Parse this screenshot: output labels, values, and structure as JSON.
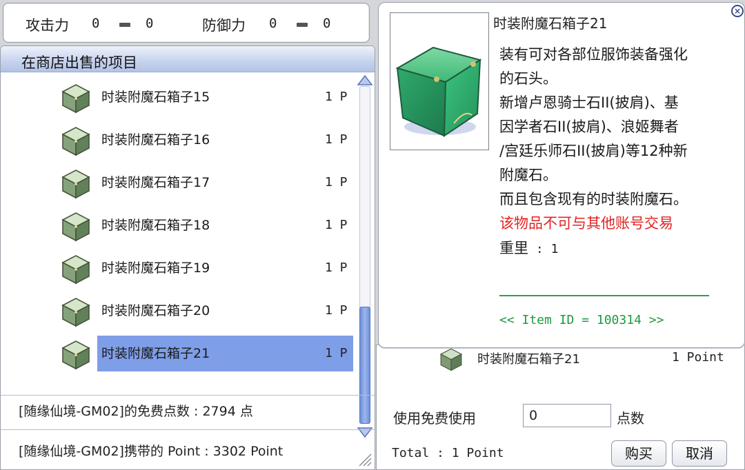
{
  "stats": {
    "attack_label": "攻击力",
    "attack_base": "0",
    "attack_bonus": "0",
    "defense_label": "防御力",
    "defense_base": "0",
    "defense_bonus": "0"
  },
  "shop": {
    "title": "在商店出售的项目",
    "items": [
      {
        "name": "时装附魔石箱子15",
        "price": "1 P",
        "selected": false
      },
      {
        "name": "时装附魔石箱子16",
        "price": "1 P",
        "selected": false
      },
      {
        "name": "时装附魔石箱子17",
        "price": "1 P",
        "selected": false
      },
      {
        "name": "时装附魔石箱子18",
        "price": "1 P",
        "selected": false
      },
      {
        "name": "时装附魔石箱子19",
        "price": "1 P",
        "selected": false
      },
      {
        "name": "时装附魔石箱子20",
        "price": "1 P",
        "selected": false
      },
      {
        "name": "时装附魔石箱子21",
        "price": "1 P",
        "selected": true
      }
    ],
    "free_points_text": "[随缘仙境-GM02]的免费点数 : 2794 点",
    "carried_points_text": "[随缘仙境-GM02]携带的 Point : 3302 Point"
  },
  "tooltip": {
    "title": "时装附魔石箱子21",
    "desc_lines": [
      "装有可对各部位服饰装备强化",
      "的石头。",
      "新增卢恩骑士石II(披肩)、基",
      "因学者石II(披肩)、浪姬舞者",
      "/宫廷乐师石II(披肩)等12种新",
      "附魔石。",
      "而且包含现有的时装附魔石。"
    ],
    "trade_warning": "该物品不可与其他账号交易",
    "weight_label": "重里",
    "weight_sep": " : ",
    "weight_value": "1",
    "item_id_text": "<< Item ID = 100314 >>"
  },
  "purchase": {
    "item_name": "时装附魔石箱子21",
    "item_points": "1 Point",
    "free_use_label": "使用免费使用",
    "free_use_value": "0",
    "points_unit": "点数",
    "total_text": "Total : 1 Point",
    "buy_label": "购买",
    "cancel_label": "取消"
  },
  "colors": {
    "selection": "#7f9ee8",
    "title_bar": "#c9d5ee",
    "warning_red": "#e22323",
    "item_id_green": "#1b9b3d"
  },
  "icons": {
    "item": "green-box-icon",
    "close": "close-circle-icon",
    "scroll_up": "arrow-up-icon",
    "scroll_down": "arrow-down-icon"
  }
}
